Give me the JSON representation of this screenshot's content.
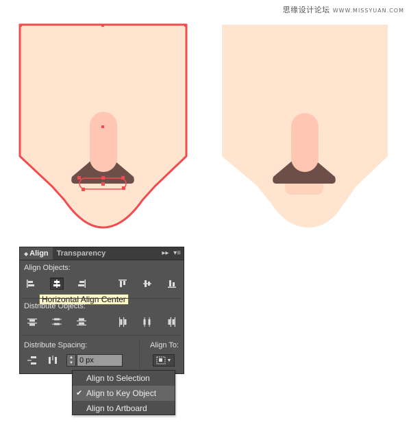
{
  "watermark": {
    "site_name": "思缘设计论坛",
    "site_url": "WWW.MISSYUAN.COM"
  },
  "colors": {
    "face_fill": "#ffe4cf",
    "selection_stroke": "#f24c4e",
    "nose_fill": "#ffc6b3",
    "mustache_fill": "#6e4e48",
    "lip_fill": "#ffd2bb",
    "panel_bg": "#535353",
    "tooltip_bg": "#fdf7c9"
  },
  "panel": {
    "tabs": [
      {
        "label": "Align",
        "active": true
      },
      {
        "label": "Transparency",
        "active": false
      }
    ],
    "sections": {
      "align_objects": "Align Objects:",
      "distribute_objects": "Distribute Objects:",
      "distribute_spacing": "Distribute Spacing:",
      "align_to": "Align To:"
    },
    "align_buttons": [
      {
        "icon": "horizontal-align-left-icon"
      },
      {
        "icon": "horizontal-align-center-icon",
        "pressed": true
      },
      {
        "icon": "horizontal-align-right-icon"
      },
      {
        "icon": "vertical-align-top-icon"
      },
      {
        "icon": "vertical-align-center-icon"
      },
      {
        "icon": "vertical-align-bottom-icon"
      }
    ],
    "distribute_buttons": [
      {
        "icon": "vertical-distribute-top-icon"
      },
      {
        "icon": "vertical-distribute-center-icon"
      },
      {
        "icon": "vertical-distribute-bottom-icon"
      },
      {
        "icon": "horizontal-distribute-left-icon"
      },
      {
        "icon": "horizontal-distribute-center-icon"
      },
      {
        "icon": "horizontal-distribute-right-icon"
      }
    ],
    "tooltip": "Horizontal Align Center",
    "spacing_value": "0 px"
  },
  "align_to_menu": [
    {
      "label": "Align to Selection",
      "checked": false
    },
    {
      "label": "Align to Key Object",
      "checked": true
    },
    {
      "label": "Align to Artboard",
      "checked": false
    }
  ]
}
